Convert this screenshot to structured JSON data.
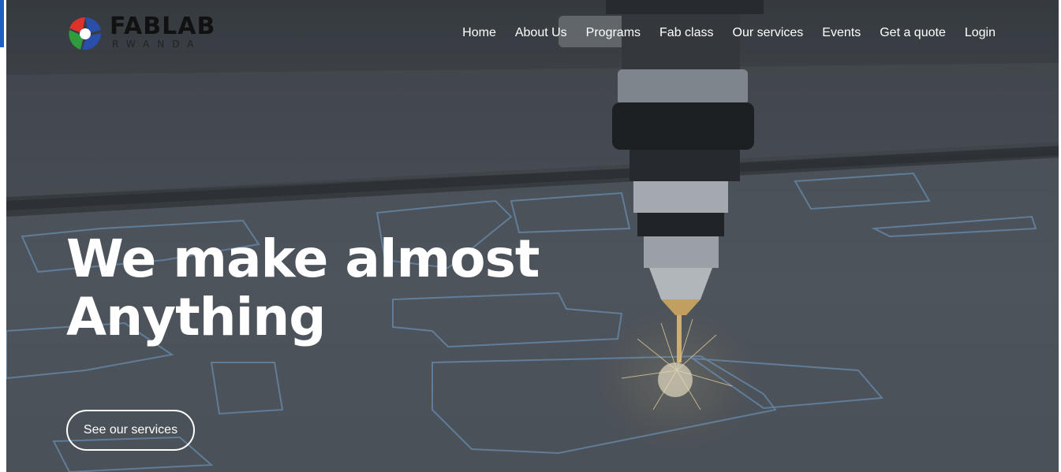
{
  "brand": {
    "name": "FABLAB",
    "tagline": "RWANDA"
  },
  "nav": {
    "items": [
      {
        "label": "Home"
      },
      {
        "label": "About Us"
      },
      {
        "label": "Programs"
      },
      {
        "label": "Fab class"
      },
      {
        "label": "Our services"
      },
      {
        "label": "Events"
      },
      {
        "label": "Get a quote"
      },
      {
        "label": "Login"
      }
    ]
  },
  "hero": {
    "headline_line1": "We make almost",
    "headline_line2": "Anything",
    "cta_label": "See our services",
    "background": "laser-cutting-machine-photo"
  },
  "colors": {
    "accent_bar": "#1f5fbf",
    "text_on_hero": "#ffffff",
    "logo_red": "#e0312b",
    "logo_green": "#2e9b3c",
    "logo_blue": "#2a4fa8"
  }
}
